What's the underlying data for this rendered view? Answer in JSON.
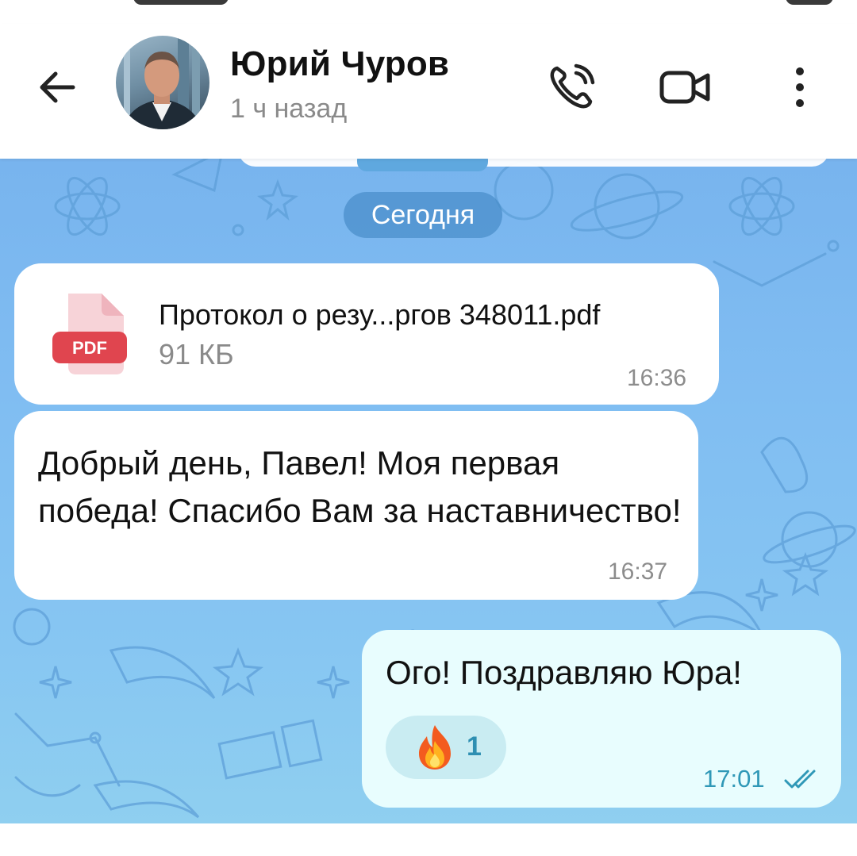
{
  "header": {
    "back_icon": "arrow-left-icon",
    "contact_name": "Юрий Чуров",
    "last_seen": "1 ч назад",
    "call_icon": "phone-icon",
    "video_icon": "video-camera-icon",
    "menu_icon": "more-vertical-icon"
  },
  "chat": {
    "date_label": "Сегодня",
    "messages": [
      {
        "type": "file",
        "direction": "incoming",
        "file_badge": "PDF",
        "file_name": "Протокол о резу...ргов 348011.pdf",
        "file_size": "91 КБ",
        "time": "16:36"
      },
      {
        "type": "text",
        "direction": "incoming",
        "text": "Добрый день, Павел! Моя первая победа! Спасибо Вам за наставничество!",
        "time": "16:37"
      },
      {
        "type": "text",
        "direction": "outgoing",
        "text": "Ого! Поздравляю Юра!",
        "reaction": {
          "emoji": "🔥",
          "count": "1"
        },
        "time": "17:01",
        "status_icon": "double-check-icon"
      }
    ]
  },
  "colors": {
    "chat_background": "#80bdf2",
    "incoming_bubble": "#ffffff",
    "outgoing_bubble": "#e8fdfe",
    "pdf_badge": "#e0454f",
    "accent_time": "#2f98b7"
  }
}
